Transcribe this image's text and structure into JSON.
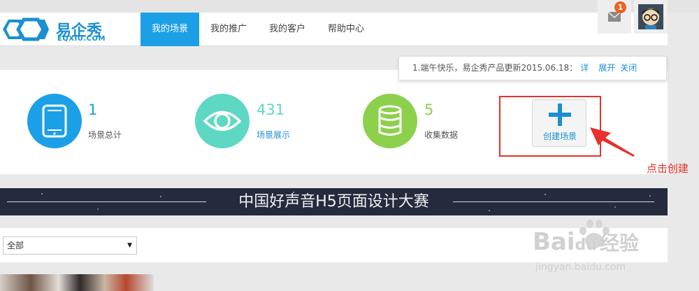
{
  "header": {
    "logo_cn": "易企秀",
    "logo_en": "EQXIU.COM",
    "nav": [
      {
        "label": "我的场景",
        "active": true
      },
      {
        "label": "我的推广",
        "active": false
      },
      {
        "label": "我的客户",
        "active": false
      },
      {
        "label": "帮助中心",
        "active": false
      }
    ],
    "mail_badge": "1",
    "icons": [
      "mail-icon",
      "avatar"
    ]
  },
  "notice": {
    "text": "1.端午快乐，易企秀产品更新2015.06.18：",
    "detail": "详",
    "expand": "展开",
    "close": "关闭"
  },
  "stats": [
    {
      "value": "1",
      "label": "场景总计",
      "color": "#1ba0e8",
      "icon": "phone-icon"
    },
    {
      "value": "431",
      "label": "场景展示",
      "color": "#5ed8c3",
      "icon": "eye-icon"
    },
    {
      "value": "5",
      "label": "收集数据",
      "color": "#8cd04c",
      "icon": "database-icon"
    }
  ],
  "create": {
    "label": "创建场景",
    "icon": "plus-icon"
  },
  "annotation": {
    "hint": "点击创建",
    "color": "#e8302c"
  },
  "banner": {
    "title": "中国好声音H5页面设计大赛"
  },
  "filter": {
    "selected": "全部"
  },
  "watermark": {
    "brand_a": "Bai",
    "brand_b": "du",
    "brand_c": "经验",
    "url": "jingyan.baidu.com"
  },
  "colors": {
    "accent": "#1ba0e8",
    "teal": "#5ed8c3",
    "green": "#8cd04c",
    "badge": "#f0611e"
  }
}
